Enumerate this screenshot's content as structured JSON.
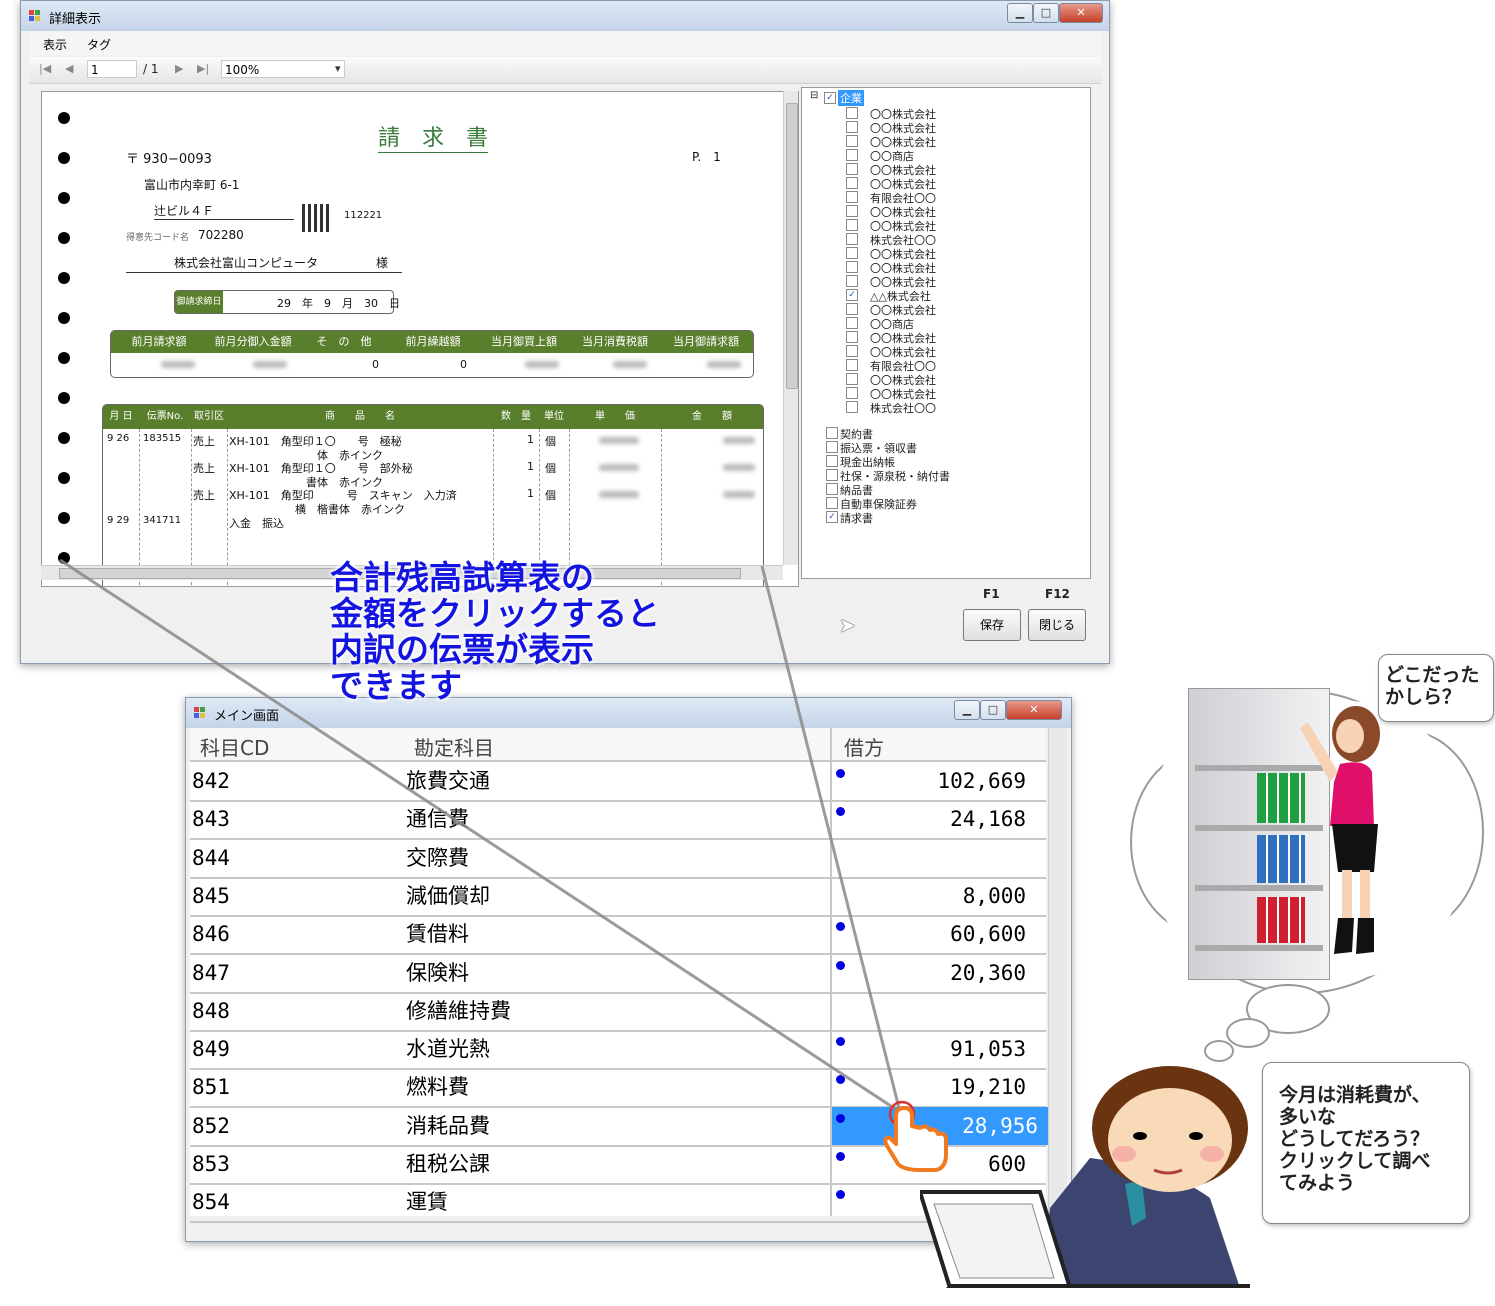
{
  "detail_window": {
    "title": "詳細表示",
    "controls": {
      "minimize": "▁",
      "maximize": "□",
      "close": "✕"
    },
    "menu": [
      "表示",
      "タグ"
    ],
    "toolbar": {
      "page": "1",
      "page_total": "/ 1",
      "zoom": "100%"
    },
    "invoice": {
      "title": "請　求　書",
      "postal": "〒 930−0093",
      "page": "P.　1",
      "address1": "富山市内幸町 6-1",
      "address2": "辻ビル４Ｆ",
      "customer_code_label": "得意先コード名",
      "customer_code": "702280",
      "qr_number": "112221",
      "customer_name": "株式会社富山コンピュータ",
      "honorific": "様",
      "date_label": "御請求締日",
      "date_value": "29　年　9　月　30　日",
      "summary_headers": [
        "前月請求額",
        "前月分御入金額",
        "そ　の　他",
        "前月繰越額",
        "当月御買上額",
        "当月消費税額",
        "当月御請求額"
      ],
      "summary_values": [
        "",
        "",
        "0",
        "0",
        "",
        "",
        ""
      ],
      "detail_headers": [
        "月 日",
        "伝票No.",
        "取引区分",
        "商　　品　　名",
        "数　量",
        "単位",
        "単　　価",
        "金　　額"
      ],
      "rows": [
        {
          "date": "9 26",
          "slip": "183515",
          "type": "売上",
          "item": "XH-101　角型印１〇　　号　極秘",
          "qty": "1",
          "unit": "個"
        },
        {
          "date": "",
          "slip": "",
          "type": "",
          "item": "　　　　　　　　体　赤インク",
          "qty": "",
          "unit": ""
        },
        {
          "date": "",
          "slip": "",
          "type": "売上",
          "item": "XH-101　角型印１〇　　号　部外秘",
          "qty": "1",
          "unit": "個"
        },
        {
          "date": "",
          "slip": "",
          "type": "",
          "item": "　　　　　　　書体　赤インク",
          "qty": "",
          "unit": ""
        },
        {
          "date": "",
          "slip": "",
          "type": "売上",
          "item": "XH-101　角型印　　　号　スキャン　入力済",
          "qty": "1",
          "unit": "個"
        },
        {
          "date": "",
          "slip": "",
          "type": "",
          "item": "　　　　　　横　楷書体　赤インク",
          "qty": "",
          "unit": ""
        },
        {
          "date": "9 29",
          "slip": "341711",
          "type": "",
          "item": "入金　振込",
          "qty": "",
          "unit": ""
        }
      ]
    },
    "tree": {
      "root": "企業",
      "companies": [
        "〇〇株式会社",
        "〇〇株式会社",
        "〇〇株式会社",
        "〇〇商店",
        "〇〇株式会社",
        "〇〇株式会社",
        "有限会社〇〇",
        "〇〇株式会社",
        "〇〇株式会社",
        "株式会社〇〇",
        "〇〇株式会社",
        "〇〇株式会社",
        "〇〇株式会社",
        "△△株式会社",
        "〇〇株式会社",
        "〇〇商店",
        "〇〇株式会社",
        "〇〇株式会社",
        "有限会社〇〇",
        "〇〇株式会社",
        "〇〇株式会社",
        "株式会社〇〇"
      ],
      "checked_company_index": 13,
      "categories": [
        "契約書",
        "振込票・領収書",
        "現金出納帳",
        "社保・源泉税・納付書",
        "納品書",
        "自動車保険証券",
        "請求書"
      ],
      "checked_category_index": 6
    },
    "buttons": {
      "save": "保存",
      "save_key": "F1",
      "close": "閉じる",
      "close_key": "F12"
    }
  },
  "overlay_text": [
    "合計残高試算表の",
    "金額をクリックすると",
    "内訳の伝票が表示",
    "できます"
  ],
  "main_window": {
    "title": "メイン画面",
    "headers": [
      "科目CD",
      "勘定科目",
      "借方"
    ],
    "rows": [
      {
        "code": "842",
        "name": "旅費交通",
        "amount": "102,669",
        "dot": true
      },
      {
        "code": "843",
        "name": "通信費",
        "amount": "24,168",
        "dot": true
      },
      {
        "code": "844",
        "name": "交際費",
        "amount": "",
        "dot": false
      },
      {
        "code": "845",
        "name": "減価償却",
        "amount": "8,000",
        "dot": false
      },
      {
        "code": "846",
        "name": "賃借料",
        "amount": "60,600",
        "dot": true
      },
      {
        "code": "847",
        "name": "保険料",
        "amount": "20,360",
        "dot": true
      },
      {
        "code": "848",
        "name": "修繕維持費",
        "amount": "",
        "dot": false
      },
      {
        "code": "849",
        "name": "水道光熱",
        "amount": "91,053",
        "dot": true
      },
      {
        "code": "851",
        "name": "燃料費",
        "amount": "19,210",
        "dot": true
      },
      {
        "code": "852",
        "name": "消耗品費",
        "amount": "28,956",
        "dot": true,
        "selected": true
      },
      {
        "code": "853",
        "name": "租税公課",
        "amount": "600",
        "dot": true
      },
      {
        "code": "854",
        "name": "運賃",
        "amount": "",
        "dot": true
      }
    ]
  },
  "woman_bubble": [
    "どこだった",
    "かしら？"
  ],
  "man_bubble": [
    "今月は消耗費が、",
    "多いな",
    "どうしてだろう？",
    "クリックして調べ",
    "てみよう"
  ],
  "colors": {
    "accent_blue": "#1414e0",
    "selection": "#3399ff",
    "invoice_green": "#5a7f2c"
  }
}
